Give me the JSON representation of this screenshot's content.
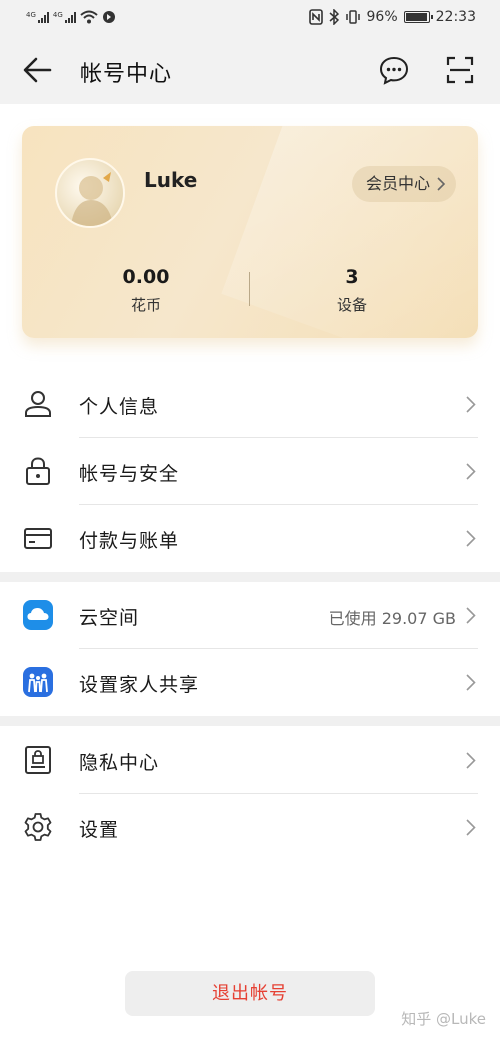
{
  "status_bar": {
    "signal1_label": "4G",
    "signal2_label": "4G",
    "battery_percent": "96%",
    "time": "22:33",
    "icons": [
      "signal-icon",
      "wifi-icon",
      "notification-icon",
      "nfc-icon",
      "bluetooth-icon",
      "vibrate-icon",
      "battery-icon"
    ]
  },
  "header": {
    "title": "帐号中心",
    "icons": [
      "back-arrow-icon",
      "message-icon",
      "scan-icon"
    ]
  },
  "profile_card": {
    "username": "Luke",
    "member_button": "会员中心",
    "stats": [
      {
        "value": "0.00",
        "label": "花币"
      },
      {
        "value": "3",
        "label": "设备"
      }
    ]
  },
  "sections": [
    [
      {
        "label": "个人信息",
        "icon": "person-icon"
      },
      {
        "label": "帐号与安全",
        "icon": "lock-icon"
      },
      {
        "label": "付款与账单",
        "icon": "card-icon"
      }
    ],
    [
      {
        "label": "云空间",
        "icon": "cloud-icon",
        "value": "已使用 29.07 GB"
      },
      {
        "label": "设置家人共享",
        "icon": "family-icon"
      }
    ],
    [
      {
        "label": "隐私中心",
        "icon": "privacy-icon"
      },
      {
        "label": "设置",
        "icon": "gear-icon"
      }
    ]
  ],
  "logout_button": "退出帐号",
  "watermark": "知乎 @Luke",
  "colors": {
    "logout_text": "#e64033",
    "card_gradient_start": "#f7e3bf",
    "cloud_icon": "#1e8ee8",
    "family_icon": "#2a6fe0"
  }
}
